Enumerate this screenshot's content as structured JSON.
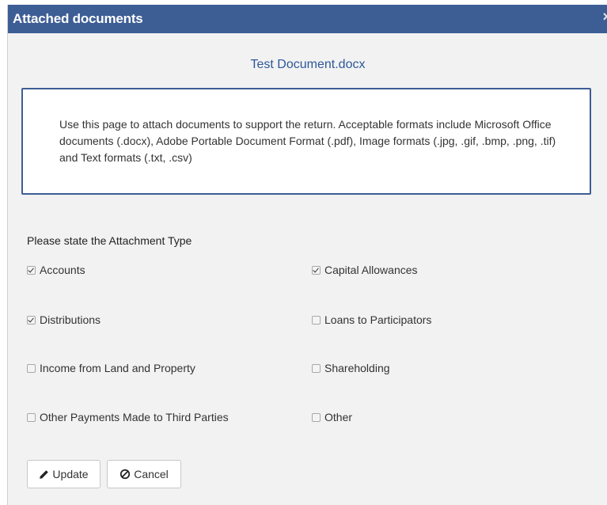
{
  "dialog": {
    "title": "Attached documents",
    "close_symbol": "×",
    "document_name": "Test Document.docx",
    "info_text": "Use this page to attach documents to support the return. Acceptable formats include Microsoft Office documents (.docx), Adobe Portable Document Format (.pdf), Image formats (.jpg, .gif, .bmp, .png, .tif) and Text formats (.txt, .csv)"
  },
  "attachment_type": {
    "label": "Please state the Attachment Type",
    "options": [
      {
        "label": "Accounts",
        "checked": true
      },
      {
        "label": "Capital Allowances",
        "checked": true
      },
      {
        "label": "Distributions",
        "checked": true
      },
      {
        "label": "Loans to Participators",
        "checked": false
      },
      {
        "label": "Income from Land and Property",
        "checked": false
      },
      {
        "label": "Shareholding",
        "checked": false
      },
      {
        "label": "Other Payments Made to Third Parties",
        "checked": false
      },
      {
        "label": "Other",
        "checked": false
      }
    ]
  },
  "buttons": {
    "update_label": "Update",
    "update_icon": "pencil-icon",
    "cancel_label": "Cancel",
    "cancel_icon": "ban-icon"
  },
  "colors": {
    "titlebar": "#3d5d95",
    "document_name": "#2d5899",
    "info_border": "#3d5d95"
  }
}
